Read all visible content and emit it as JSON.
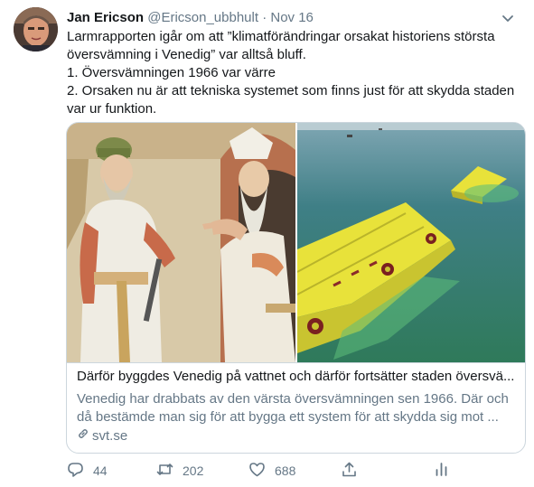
{
  "tweet": {
    "name": "Jan Ericson",
    "handle": "@Ericson_ubbhult",
    "separator": "·",
    "date": "Nov 16",
    "lines": [
      "Larmrapporten igår om att ”klimatförändringar orsakat historiens största",
      "översvämning i Venedig” var alltså bluff.",
      "1. Översvämningen 1966 var värre",
      "2. Orsaken nu är att tekniska systemet som finns just för att skydda staden",
      "var ur funktion."
    ]
  },
  "card": {
    "title": "Därför byggdes Venedig på vattnet och därför fortsätter staden översvä...",
    "description": "Venedig har drabbats av den värsta översvämningen sen 1966. Där och då bestämde man sig för att bygga ett system för att skydda sig mot ...",
    "domain": "svt.se"
  },
  "actions": {
    "reply_count": "44",
    "retweet_count": "202",
    "like_count": "688"
  },
  "colors": {
    "text_primary": "#14171a",
    "text_secondary": "#657786",
    "border": "#ccd6dd",
    "barrier_yellow": "#e8e23a",
    "lagoon_green": "#3e8f6e"
  },
  "icons": [
    "chevron-down-icon",
    "link-icon",
    "reply-icon",
    "retweet-icon",
    "like-icon",
    "share-icon",
    "analytics-icon"
  ]
}
